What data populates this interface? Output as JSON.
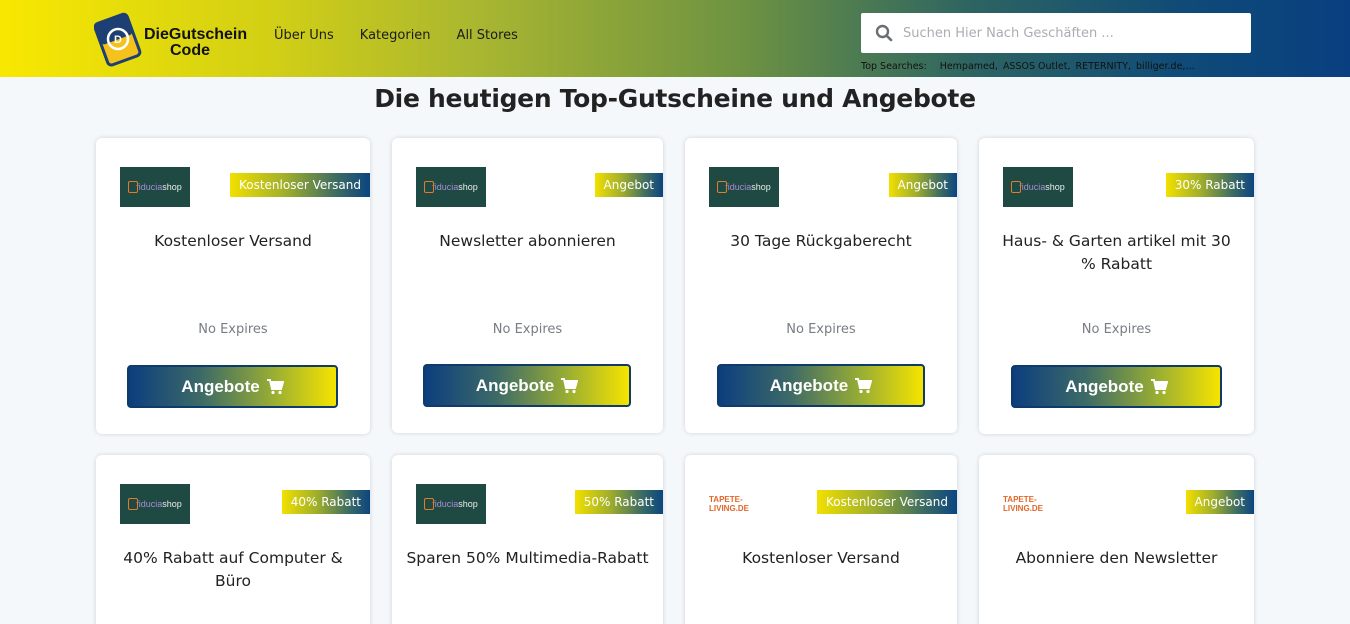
{
  "header": {
    "logo": {
      "line1": "DieGutschein",
      "line2": "Code"
    },
    "nav": [
      "Über Uns",
      "Kategorien",
      "All Stores"
    ],
    "search": {
      "placeholder": "Suchen Hier Nach Geschäften ..."
    },
    "top_searches": {
      "label": "Top Searches:",
      "items": [
        "Hempamed,",
        "ASSOS Outlet,",
        "RETERNITY,",
        "billiger.de,..."
      ]
    }
  },
  "page_title": "Die heutigen Top-Gutscheine und Angebote",
  "cards": [
    {
      "store": "fiduciashop",
      "badge": "Kostenloser Versand",
      "title": "Kostenloser Versand",
      "expires": "No Expires",
      "button": "Angebote"
    },
    {
      "store": "fiduciashop",
      "badge": "Angebot",
      "title": "Newsletter abonnieren",
      "expires": "No Expires",
      "button": "Angebote"
    },
    {
      "store": "fiduciashop",
      "badge": "Angebot",
      "title": "30 Tage Rückgaberecht",
      "expires": "No Expires",
      "button": "Angebote"
    },
    {
      "store": "fiduciashop",
      "badge": "30% Rabatt",
      "title": "Haus- & Garten artikel mit 30 % Rabatt",
      "expires": "No Expires",
      "button": "Angebote"
    },
    {
      "store": "fiduciashop",
      "badge": "40% Rabatt",
      "title": "40% Rabatt auf Computer & Büro",
      "expires": "",
      "button": ""
    },
    {
      "store": "fiduciashop",
      "badge": "50% Rabatt",
      "title": "Sparen 50% Multimedia-Rabatt",
      "expires": "",
      "button": ""
    },
    {
      "store": "TAPETE-LIVING.DE",
      "badge": "Kostenloser Versand",
      "title": "Kostenloser Versand",
      "expires": "",
      "button": ""
    },
    {
      "store": "TAPETE-LIVING.DE",
      "badge": "Angebot",
      "title": "Abonniere den Newsletter",
      "expires": "",
      "button": ""
    }
  ],
  "colors": {
    "brand_yellow": "#f8e801",
    "brand_blue": "#093f80",
    "button_border": "#0f3b6a",
    "store_logo_bg": "#1f4a43"
  },
  "icons": [
    "search-icon",
    "cart-icon",
    "logo-mark-icon"
  ]
}
